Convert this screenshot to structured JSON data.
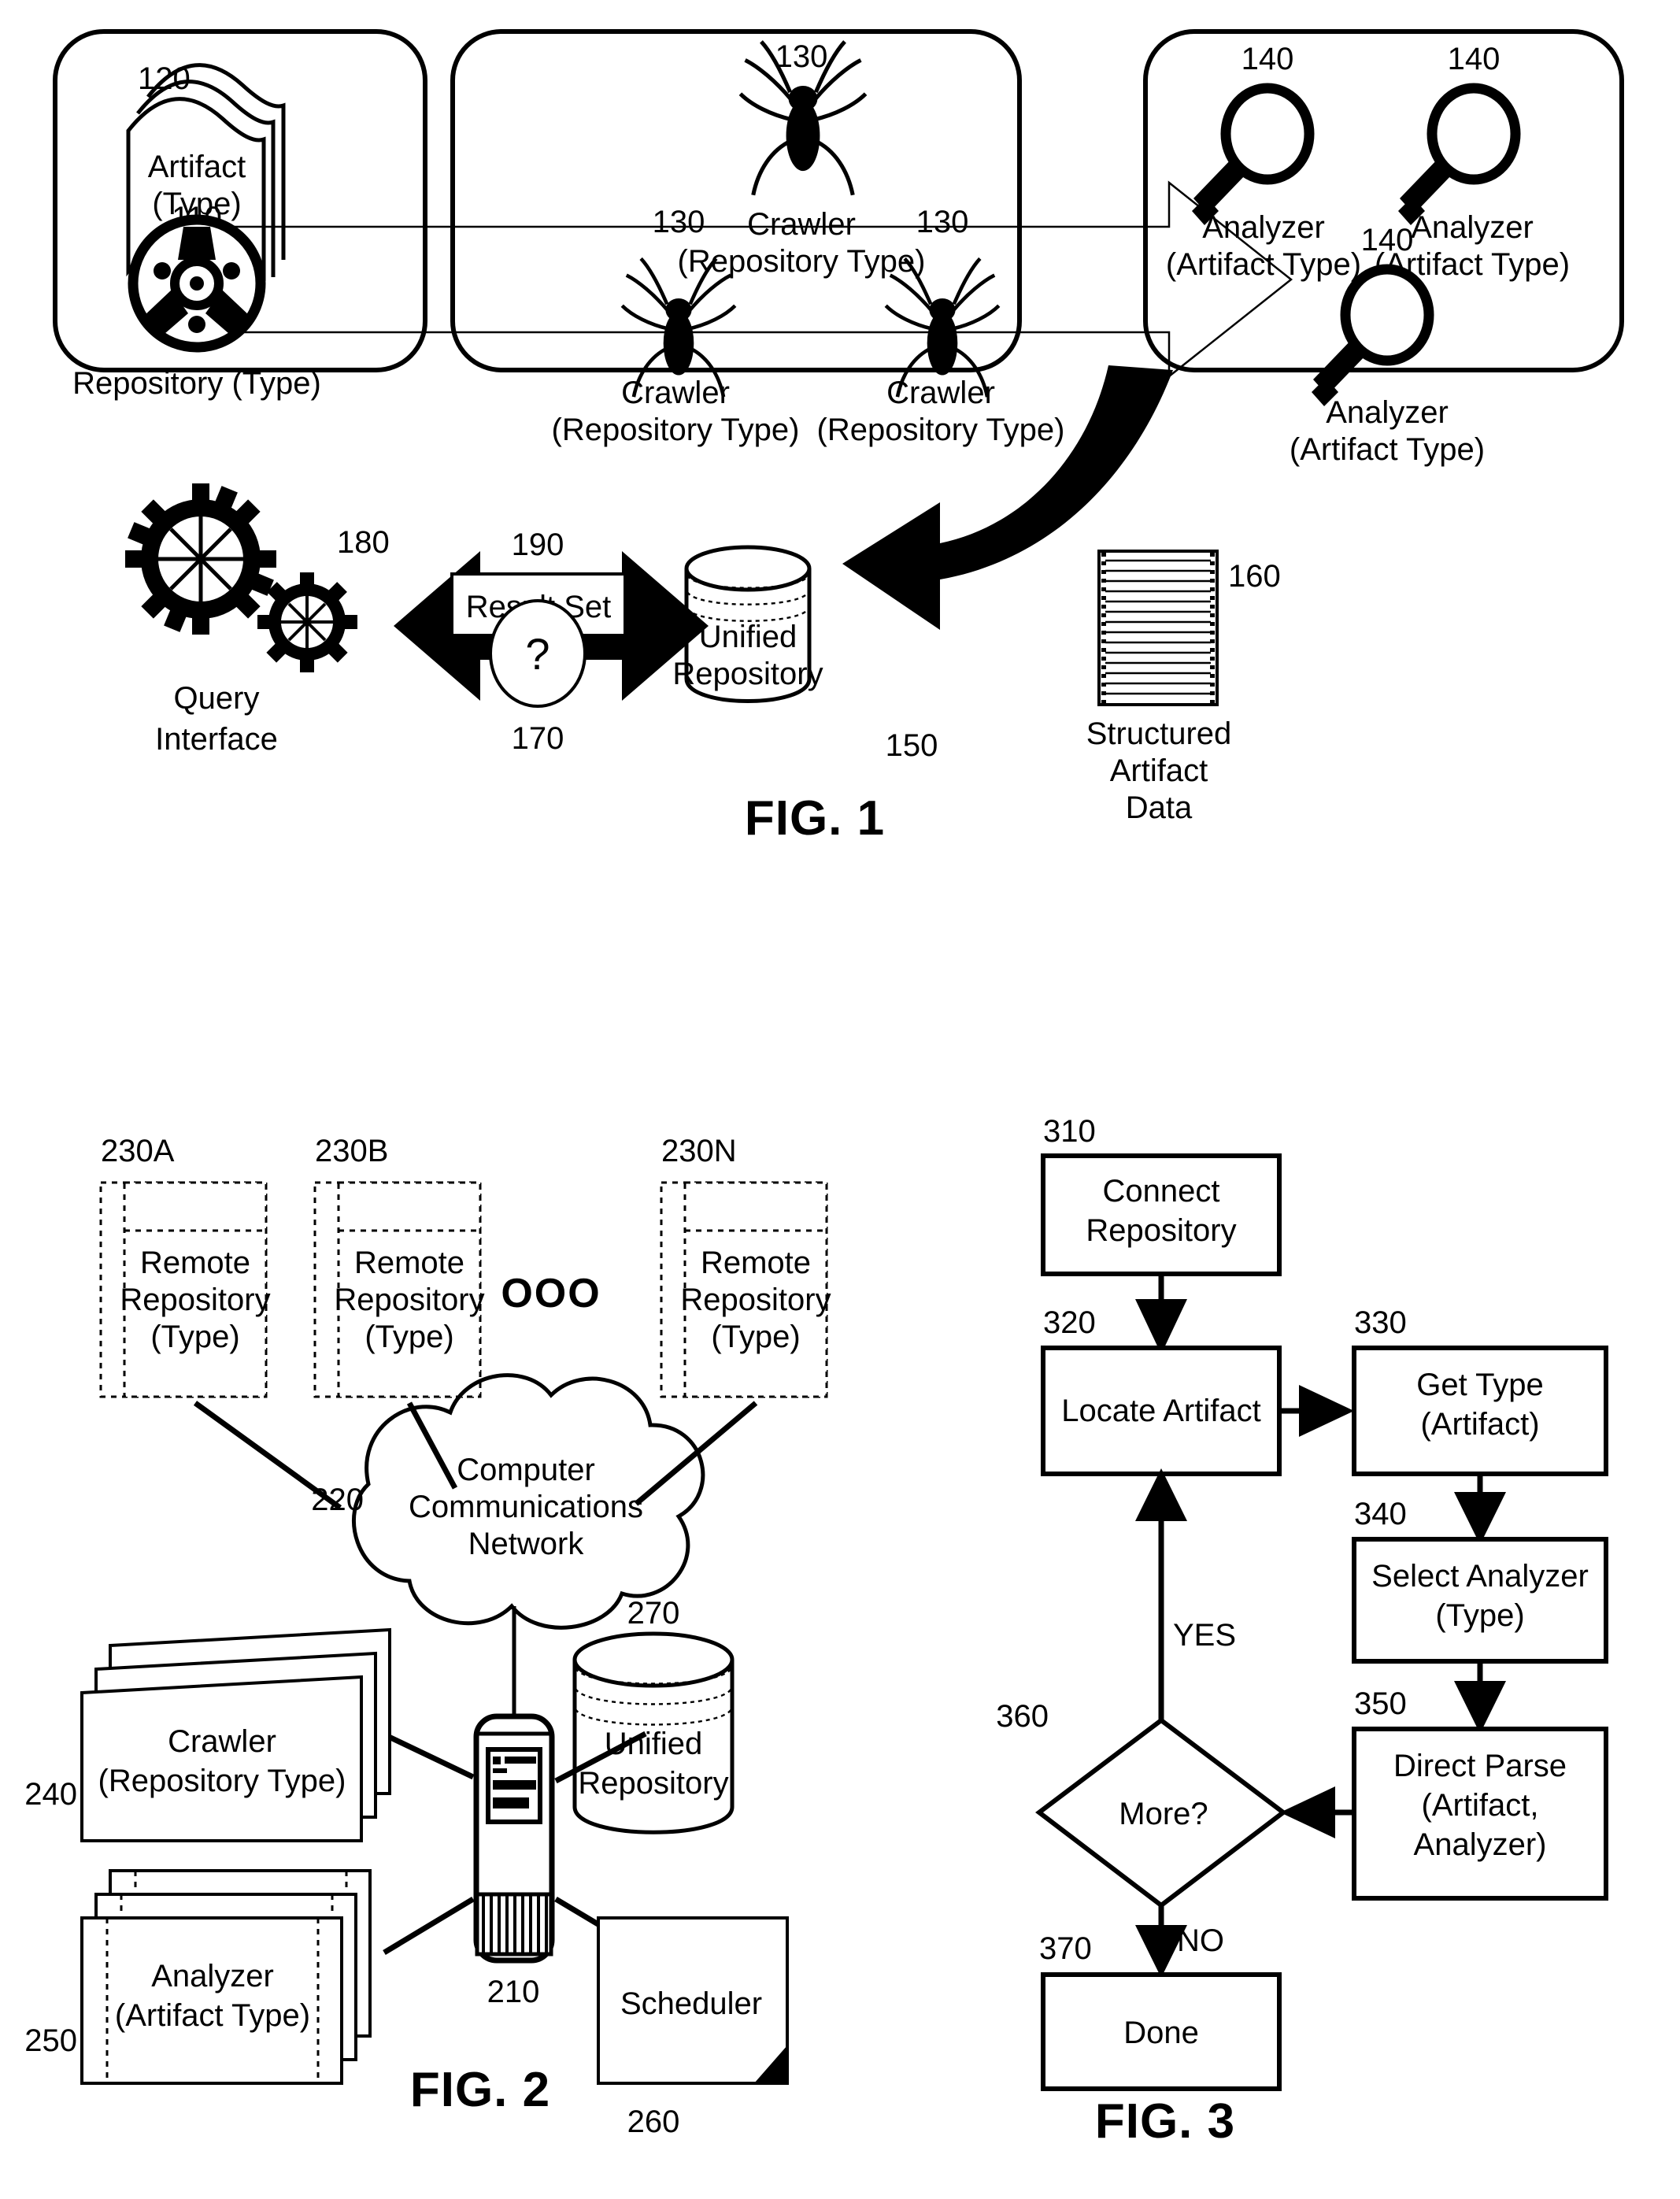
{
  "document": {
    "type": "patent-drawing-sheet",
    "figure_count": 3
  },
  "fig1": {
    "caption": "FIG. 1",
    "group_repository": {
      "artifact_ref": "120",
      "artifact_label_line1": "Artifact",
      "artifact_label_line2": "(Type)",
      "repository_ref": "110",
      "repository_label": "Repository (Type)"
    },
    "group_crawler": {
      "crawlers": [
        {
          "ref": "130",
          "label_line1": "Crawler",
          "label_line2": "(Repository Type)"
        },
        {
          "ref": "130",
          "label_line1": "Crawler",
          "label_line2": "(Repository Type)"
        },
        {
          "ref": "130",
          "label_line1": "Crawler",
          "label_line2": "(Repository Type)"
        }
      ]
    },
    "group_analyzer": {
      "analyzers": [
        {
          "ref": "140",
          "label_line1": "Analyzer",
          "label_line2": "(Artifact Type)"
        },
        {
          "ref": "140",
          "label_line1": "Analyzer",
          "label_line2": "(Artifact Type)"
        },
        {
          "ref": "140",
          "label_line1": "Analyzer",
          "label_line2": "(Artifact Type)"
        }
      ]
    },
    "bottom": {
      "query_interface_ref": "180",
      "query_interface_line1": "Query",
      "query_interface_line2": "Interface",
      "result_set_ref": "190",
      "result_set_label": "Result Set",
      "question_ref": "170",
      "question_mark": "?",
      "unified_repository_ref": "150",
      "unified_repository_line1": "Unified",
      "unified_repository_line2": "Repository",
      "structured_data_ref": "160",
      "structured_data_line1": "Structured",
      "structured_data_line2": "Artifact",
      "structured_data_line3": "Data"
    }
  },
  "fig2": {
    "caption": "FIG. 2",
    "remote_repositories": [
      {
        "ref": "230A",
        "line1": "Remote",
        "line2": "Repository",
        "line3": "(Type)"
      },
      {
        "ref": "230B",
        "line1": "Remote",
        "line2": "Repository",
        "line3": "(Type)"
      },
      {
        "ref": "230N",
        "line1": "Remote",
        "line2": "Repository",
        "line3": "(Type)"
      }
    ],
    "ellipsis": "OOO",
    "network": {
      "ref": "220",
      "line1": "Computer",
      "line2": "Communications",
      "line3": "Network"
    },
    "server_ref": "210",
    "crawler": {
      "ref": "240",
      "line1": "Crawler",
      "line2": "(Repository Type)"
    },
    "analyzer": {
      "ref": "250",
      "line1": "Analyzer",
      "line2": "(Artifact Type)"
    },
    "unified_repository": {
      "ref": "270",
      "line1": "Unified",
      "line2": "Repository"
    },
    "scheduler": {
      "ref": "260",
      "label": "Scheduler"
    }
  },
  "fig3": {
    "caption": "FIG. 3",
    "steps": [
      {
        "ref": "310",
        "line1": "Connect",
        "line2": "Repository"
      },
      {
        "ref": "320",
        "line1": "Locate Artifact",
        "line2": ""
      },
      {
        "ref": "330",
        "line1": "Get Type",
        "line2": "(Artifact)"
      },
      {
        "ref": "340",
        "line1": "Select Analyzer",
        "line2": "(Type)"
      },
      {
        "ref": "350",
        "line1": "Direct Parse",
        "line2": "(Artifact,",
        "line3": "Analyzer)"
      },
      {
        "ref": "360",
        "line1": "More?",
        "line2": ""
      },
      {
        "ref": "370",
        "line1": "Done",
        "line2": ""
      }
    ],
    "branch_yes": "YES",
    "branch_no": "NO"
  },
  "colors": {
    "ink": "#000000",
    "paper": "#ffffff"
  }
}
